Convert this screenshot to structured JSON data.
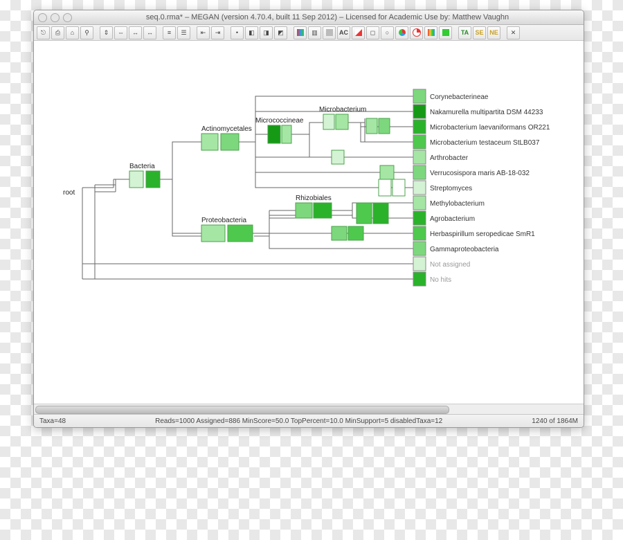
{
  "window": {
    "title": "seq.0.rma* – MEGAN (version 4.70.4, built 11 Sep 2012) – Licensed for Academic Use by: Matthew Vaughn"
  },
  "status": {
    "left": "Taxa=48",
    "center": "Reads=1000 Assigned=886 MinScore=50.0 TopPercent=10.0 MinSupport=5 disabledTaxa=12",
    "right": "1240 of 1864M"
  },
  "tree": {
    "root_label": "root",
    "internal": {
      "bacteria": "Bacteria",
      "actinomycetales": "Actinomycetales",
      "micrococcineae": "Micrococcineae",
      "microbacterium": "Microbacterium",
      "proteobacteria": "Proteobacteria",
      "rhizobiales": "Rhizobiales"
    },
    "leaves": [
      "Corynebacterineae",
      "Nakamurella multipartita DSM 44233",
      "Microbacterium laevaniformans OR221",
      "Microbacterium testaceum StLB037",
      "Arthrobacter",
      "Verrucosispora maris AB-18-032",
      "Streptomyces",
      "Methylobacterium",
      "Agrobacterium",
      "Herbaspirillum seropedicae SmR1",
      "Gammaproteobacteria",
      "Not assigned",
      "No hits"
    ]
  },
  "toolbar_glyphs": [
    "⎋",
    "⎙",
    "⌂",
    "⚲",
    "✂",
    "⇕",
    "⇔",
    "↔",
    "≡",
    "☰",
    "⇤",
    "⇥",
    "•",
    "◧",
    "◨",
    "◩",
    "▥",
    "AC",
    "◿",
    "◻",
    "○",
    "◑",
    "◔",
    "▦",
    "▤",
    "TA",
    "SE",
    "NE",
    "✕"
  ]
}
